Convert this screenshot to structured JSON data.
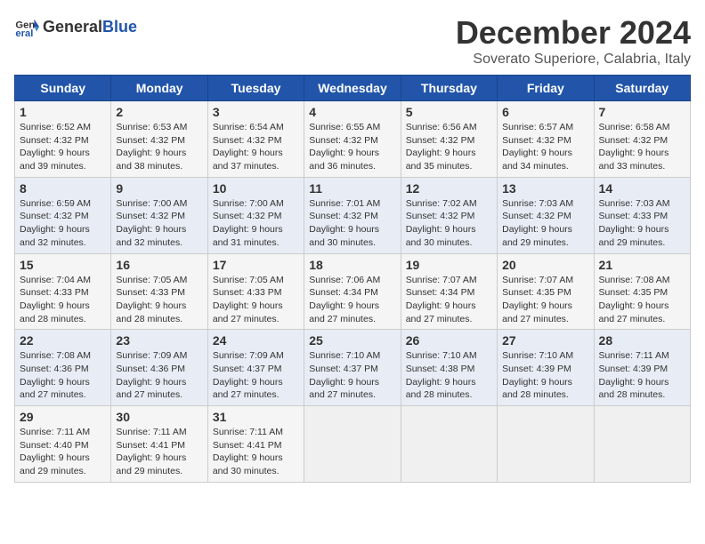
{
  "logo": {
    "text_general": "General",
    "text_blue": "Blue"
  },
  "title": "December 2024",
  "subtitle": "Soverato Superiore, Calabria, Italy",
  "headers": [
    "Sunday",
    "Monday",
    "Tuesday",
    "Wednesday",
    "Thursday",
    "Friday",
    "Saturday"
  ],
  "weeks": [
    [
      {
        "day": "1",
        "sunrise": "6:52 AM",
        "sunset": "4:32 PM",
        "daylight": "9 hours and 39 minutes."
      },
      {
        "day": "2",
        "sunrise": "6:53 AM",
        "sunset": "4:32 PM",
        "daylight": "9 hours and 38 minutes."
      },
      {
        "day": "3",
        "sunrise": "6:54 AM",
        "sunset": "4:32 PM",
        "daylight": "9 hours and 37 minutes."
      },
      {
        "day": "4",
        "sunrise": "6:55 AM",
        "sunset": "4:32 PM",
        "daylight": "9 hours and 36 minutes."
      },
      {
        "day": "5",
        "sunrise": "6:56 AM",
        "sunset": "4:32 PM",
        "daylight": "9 hours and 35 minutes."
      },
      {
        "day": "6",
        "sunrise": "6:57 AM",
        "sunset": "4:32 PM",
        "daylight": "9 hours and 34 minutes."
      },
      {
        "day": "7",
        "sunrise": "6:58 AM",
        "sunset": "4:32 PM",
        "daylight": "9 hours and 33 minutes."
      }
    ],
    [
      {
        "day": "8",
        "sunrise": "6:59 AM",
        "sunset": "4:32 PM",
        "daylight": "9 hours and 32 minutes."
      },
      {
        "day": "9",
        "sunrise": "7:00 AM",
        "sunset": "4:32 PM",
        "daylight": "9 hours and 32 minutes."
      },
      {
        "day": "10",
        "sunrise": "7:00 AM",
        "sunset": "4:32 PM",
        "daylight": "9 hours and 31 minutes."
      },
      {
        "day": "11",
        "sunrise": "7:01 AM",
        "sunset": "4:32 PM",
        "daylight": "9 hours and 30 minutes."
      },
      {
        "day": "12",
        "sunrise": "7:02 AM",
        "sunset": "4:32 PM",
        "daylight": "9 hours and 30 minutes."
      },
      {
        "day": "13",
        "sunrise": "7:03 AM",
        "sunset": "4:32 PM",
        "daylight": "9 hours and 29 minutes."
      },
      {
        "day": "14",
        "sunrise": "7:03 AM",
        "sunset": "4:33 PM",
        "daylight": "9 hours and 29 minutes."
      }
    ],
    [
      {
        "day": "15",
        "sunrise": "7:04 AM",
        "sunset": "4:33 PM",
        "daylight": "9 hours and 28 minutes."
      },
      {
        "day": "16",
        "sunrise": "7:05 AM",
        "sunset": "4:33 PM",
        "daylight": "9 hours and 28 minutes."
      },
      {
        "day": "17",
        "sunrise": "7:05 AM",
        "sunset": "4:33 PM",
        "daylight": "9 hours and 27 minutes."
      },
      {
        "day": "18",
        "sunrise": "7:06 AM",
        "sunset": "4:34 PM",
        "daylight": "9 hours and 27 minutes."
      },
      {
        "day": "19",
        "sunrise": "7:07 AM",
        "sunset": "4:34 PM",
        "daylight": "9 hours and 27 minutes."
      },
      {
        "day": "20",
        "sunrise": "7:07 AM",
        "sunset": "4:35 PM",
        "daylight": "9 hours and 27 minutes."
      },
      {
        "day": "21",
        "sunrise": "7:08 AM",
        "sunset": "4:35 PM",
        "daylight": "9 hours and 27 minutes."
      }
    ],
    [
      {
        "day": "22",
        "sunrise": "7:08 AM",
        "sunset": "4:36 PM",
        "daylight": "9 hours and 27 minutes."
      },
      {
        "day": "23",
        "sunrise": "7:09 AM",
        "sunset": "4:36 PM",
        "daylight": "9 hours and 27 minutes."
      },
      {
        "day": "24",
        "sunrise": "7:09 AM",
        "sunset": "4:37 PM",
        "daylight": "9 hours and 27 minutes."
      },
      {
        "day": "25",
        "sunrise": "7:10 AM",
        "sunset": "4:37 PM",
        "daylight": "9 hours and 27 minutes."
      },
      {
        "day": "26",
        "sunrise": "7:10 AM",
        "sunset": "4:38 PM",
        "daylight": "9 hours and 28 minutes."
      },
      {
        "day": "27",
        "sunrise": "7:10 AM",
        "sunset": "4:39 PM",
        "daylight": "9 hours and 28 minutes."
      },
      {
        "day": "28",
        "sunrise": "7:11 AM",
        "sunset": "4:39 PM",
        "daylight": "9 hours and 28 minutes."
      }
    ],
    [
      {
        "day": "29",
        "sunrise": "7:11 AM",
        "sunset": "4:40 PM",
        "daylight": "9 hours and 29 minutes."
      },
      {
        "day": "30",
        "sunrise": "7:11 AM",
        "sunset": "4:41 PM",
        "daylight": "9 hours and 29 minutes."
      },
      {
        "day": "31",
        "sunrise": "7:11 AM",
        "sunset": "4:41 PM",
        "daylight": "9 hours and 30 minutes."
      },
      null,
      null,
      null,
      null
    ]
  ],
  "labels": {
    "sunrise": "Sunrise:",
    "sunset": "Sunset:",
    "daylight": "Daylight:"
  }
}
